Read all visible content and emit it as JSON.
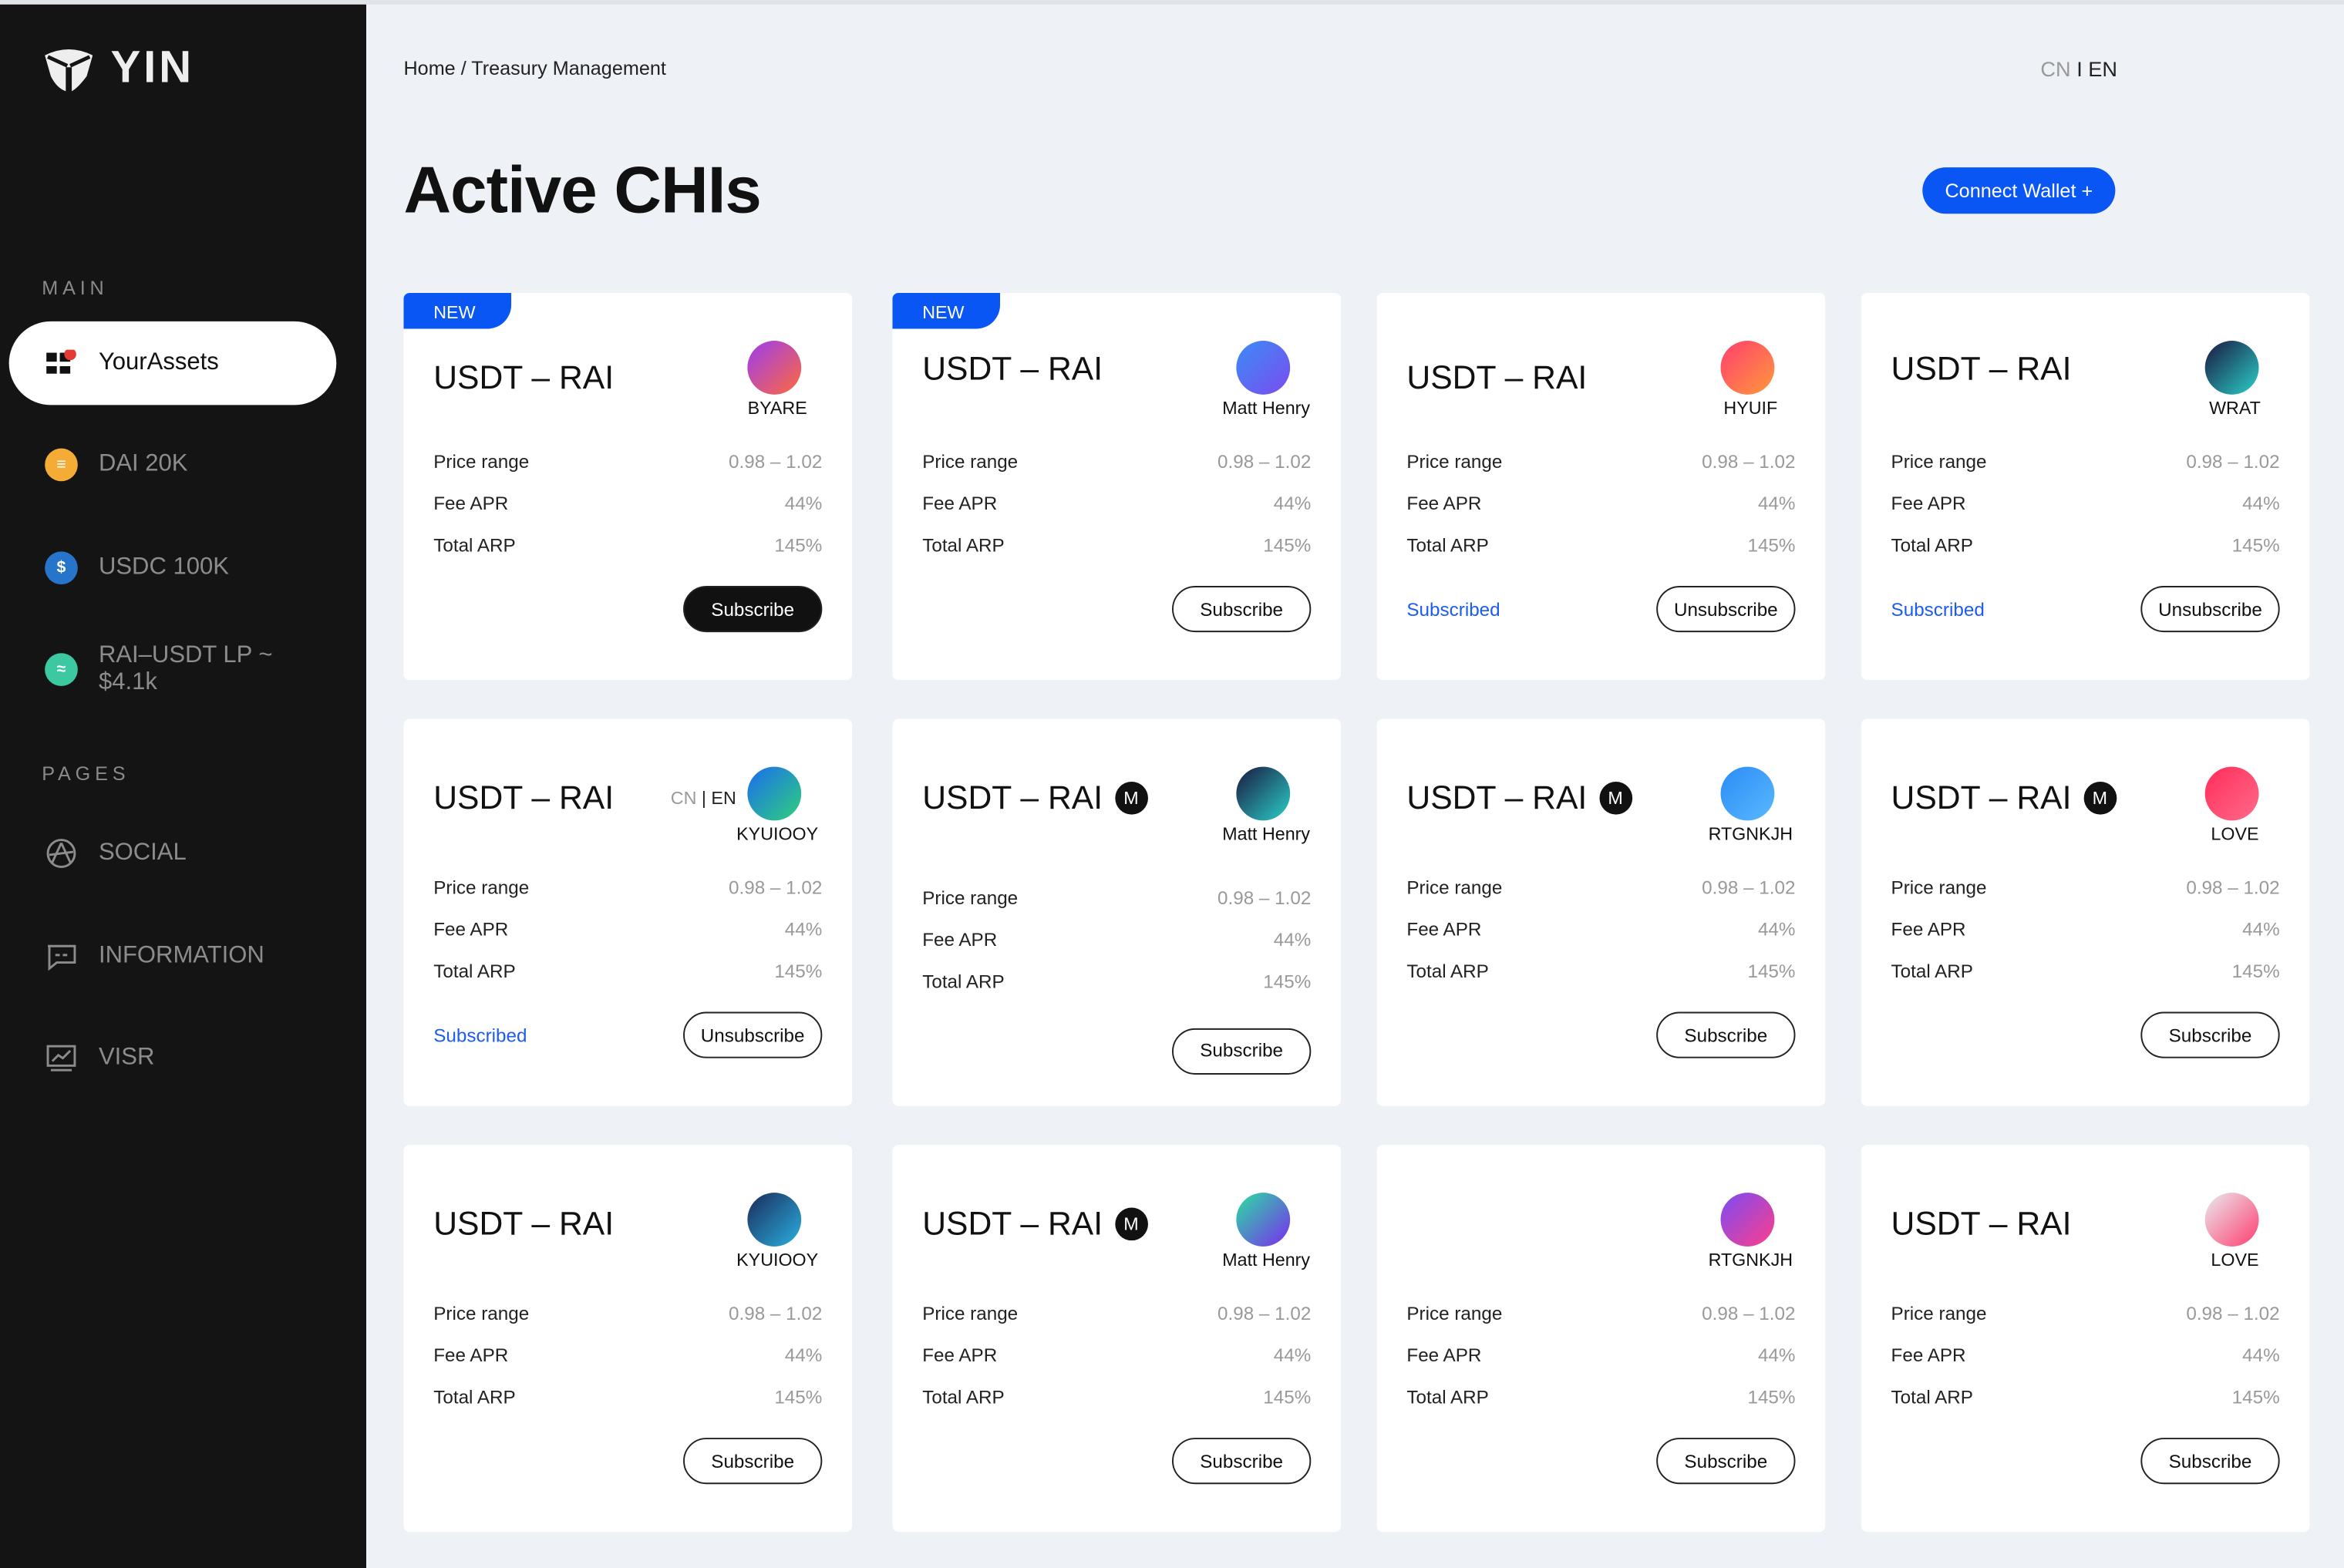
{
  "brand": {
    "name": "YIN"
  },
  "sidebar": {
    "main_label": "MAIN",
    "main_items": [
      {
        "label": "YourAssets",
        "icon": "dashboard-icon",
        "active": true,
        "color": "#111"
      },
      {
        "label": "DAI 20K",
        "icon": "dai-coin-icon",
        "color": "#f5ac37"
      },
      {
        "label": "USDC 100K",
        "icon": "usdc-coin-icon",
        "color": "#2775ca"
      },
      {
        "label": "RAI–USDT LP ~ $4.1k",
        "icon": "rai-coin-icon",
        "color": "#3cc8a0"
      }
    ],
    "pages_label": "PAGES",
    "pages": [
      {
        "label": "SOCIAL",
        "icon": "social-icon"
      },
      {
        "label": "INFORMATION",
        "icon": "message-icon"
      },
      {
        "label": "VISR",
        "icon": "chart-icon"
      }
    ]
  },
  "header": {
    "breadcrumb": "Home / Treasury Management",
    "lang_cn": "CN",
    "lang_sep": "I",
    "lang_en": "EN",
    "title": "Active CHIs",
    "connect_wallet": "Connect Wallet +"
  },
  "labels": {
    "price_range": "Price range",
    "fee_apr": "Fee APR",
    "total_arp": "Total ARP",
    "new": "NEW",
    "m": "M",
    "cn": "CN",
    "sep": "|",
    "en": "EN"
  },
  "colors": {
    "accent": "#0a56f5",
    "subscribed": "#1d5cf0"
  },
  "cards": [
    {
      "new": true,
      "title": "USDT – RAI",
      "m": false,
      "lang": false,
      "name": "BYARE",
      "logo": [
        "#9b3cf0",
        "#ff6a3c"
      ],
      "price": "0.98 – 1.02",
      "fee": "44%",
      "total": "145%",
      "status": "",
      "button": "Subscribe",
      "dark": true
    },
    {
      "new": true,
      "title": "USDT – RAI",
      "m": false,
      "lang": false,
      "name": "Matt Henry",
      "logo": [
        "#3b8cf5",
        "#7b4cf0"
      ],
      "price": "0.98 – 1.02",
      "fee": "44%",
      "total": "145%",
      "status": "",
      "button": "Subscribe",
      "dark": false
    },
    {
      "new": false,
      "title": "USDT – RAI",
      "m": false,
      "lang": false,
      "name": "HYUIF",
      "logo": [
        "#ff3d6e",
        "#ff9a3c"
      ],
      "price": "0.98 – 1.02",
      "fee": "44%",
      "total": "145%",
      "status": "Subscribed",
      "button": "Unsubscribe",
      "dark": false
    },
    {
      "new": false,
      "title": "USDT – RAI",
      "m": false,
      "lang": false,
      "name": "WRAT",
      "logo": [
        "#1a1640",
        "#2ad0c8"
      ],
      "price": "0.98 – 1.02",
      "fee": "44%",
      "total": "145%",
      "status": "Subscribed",
      "button": "Unsubscribe",
      "dark": false
    },
    {
      "new": false,
      "title": "USDT – RAI",
      "m": false,
      "lang": true,
      "name": "KYUIOOY",
      "logo": [
        "#1a6cf0",
        "#2fd07a"
      ],
      "price": "0.98 – 1.02",
      "fee": "44%",
      "total": "145%",
      "status": "Subscribed",
      "button": "Unsubscribe",
      "dark": false
    },
    {
      "new": false,
      "title": "USDT – RAI",
      "m": true,
      "lang": false,
      "name": "Matt Henry",
      "logo": [
        "#1a1640",
        "#2ad0c8"
      ],
      "price": "0.98 – 1.02",
      "fee": "44%",
      "total": "145%",
      "status": "",
      "button": "Subscribe",
      "dark": false
    },
    {
      "new": false,
      "title": "USDT – RAI",
      "m": true,
      "lang": false,
      "name": "RTGNKJH",
      "logo": [
        "#2a8cf5",
        "#5ab8ff"
      ],
      "price": "0.98 – 1.02",
      "fee": "44%",
      "total": "145%",
      "status": "",
      "button": "Subscribe",
      "dark": false
    },
    {
      "new": false,
      "title": "USDT – RAI",
      "m": true,
      "lang": false,
      "name": "LOVE",
      "logo": [
        "#ff2d5a",
        "#ff6a8a"
      ],
      "price": "0.98 – 1.02",
      "fee": "44%",
      "total": "145%",
      "status": "",
      "button": "Subscribe",
      "dark": false
    },
    {
      "new": false,
      "title": "USDT – RAI",
      "m": false,
      "lang": false,
      "name": "KYUIOOY",
      "logo": [
        "#1a2a5a",
        "#2ab0e0"
      ],
      "price": "0.98 – 1.02",
      "fee": "44%",
      "total": "145%",
      "status": "",
      "button": "Subscribe",
      "dark": false
    },
    {
      "new": false,
      "title": "USDT – RAI",
      "m": true,
      "lang": false,
      "name": "Matt Henry",
      "logo": [
        "#2ae0a0",
        "#7a2af0"
      ],
      "price": "0.98 – 1.02",
      "fee": "44%",
      "total": "145%",
      "status": "",
      "button": "Subscribe",
      "dark": false
    },
    {
      "new": false,
      "title": "",
      "m": false,
      "lang": false,
      "name": "RTGNKJH",
      "logo": [
        "#7a4cf5",
        "#ff3d8a"
      ],
      "price": "0.98 – 1.02",
      "fee": "44%",
      "total": "145%",
      "status": "",
      "button": "Subscribe",
      "dark": false
    },
    {
      "new": false,
      "title": "USDT – RAI",
      "m": false,
      "lang": false,
      "name": "LOVE",
      "logo": [
        "#e8ecf0",
        "#ff3d6e"
      ],
      "price": "0.98 – 1.02",
      "fee": "44%",
      "total": "145%",
      "status": "",
      "button": "Subscribe",
      "dark": false
    }
  ]
}
